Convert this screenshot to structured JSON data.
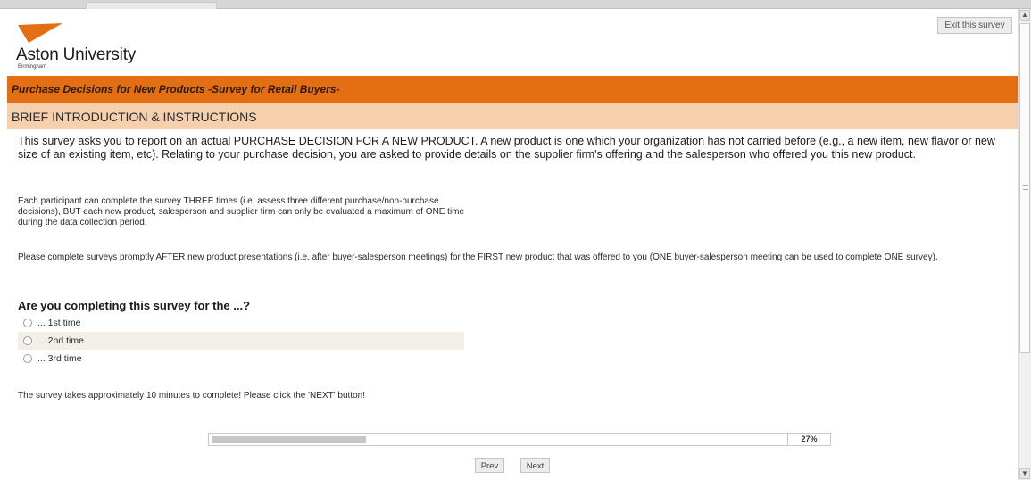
{
  "header": {
    "logo_name": "Aston University",
    "logo_sub": "Birmingham",
    "exit_label": "Exit this survey"
  },
  "survey": {
    "title": "Purchase Decisions for New Products -Survey for Retail Buyers-",
    "section": "BRIEF INTRODUCTION & INSTRUCTIONS",
    "intro": "This survey asks you to report on an actual PURCHASE DECISION FOR A NEW PRODUCT. A new product is one which your organization has not carried before (e.g., a new item, new flavor or new size of an existing item, etc). Relating to your purchase decision, you are asked to provide details on the supplier firm's offering and the salesperson who offered you this new product.",
    "para2": "Each participant can complete the survey THREE times (i.e. assess three different purchase/non-purchase decisions), BUT each new product, salesperson and supplier firm can only be evaluated a maximum of ONE time during the data collection period.",
    "para3": "Please complete surveys promptly AFTER new product presentations (i.e. after buyer-salesperson meetings) for the FIRST new product that was offered to you (ONE buyer-salesperson meeting can be used to complete ONE survey).",
    "question": "Are you completing this survey for the ...?",
    "options": [
      {
        "label": "... 1st time"
      },
      {
        "label": "... 2nd time"
      },
      {
        "label": "... 3rd time"
      }
    ],
    "closing": "The survey takes approximately 10 minutes to complete! Please click the 'NEXT' button!"
  },
  "progress": {
    "value": 0.27,
    "label": "27%"
  },
  "nav": {
    "prev_label": "Prev",
    "next_label": "Next"
  },
  "colors": {
    "brand_orange": "#e36f12",
    "section_peach": "#f6d0ad"
  }
}
